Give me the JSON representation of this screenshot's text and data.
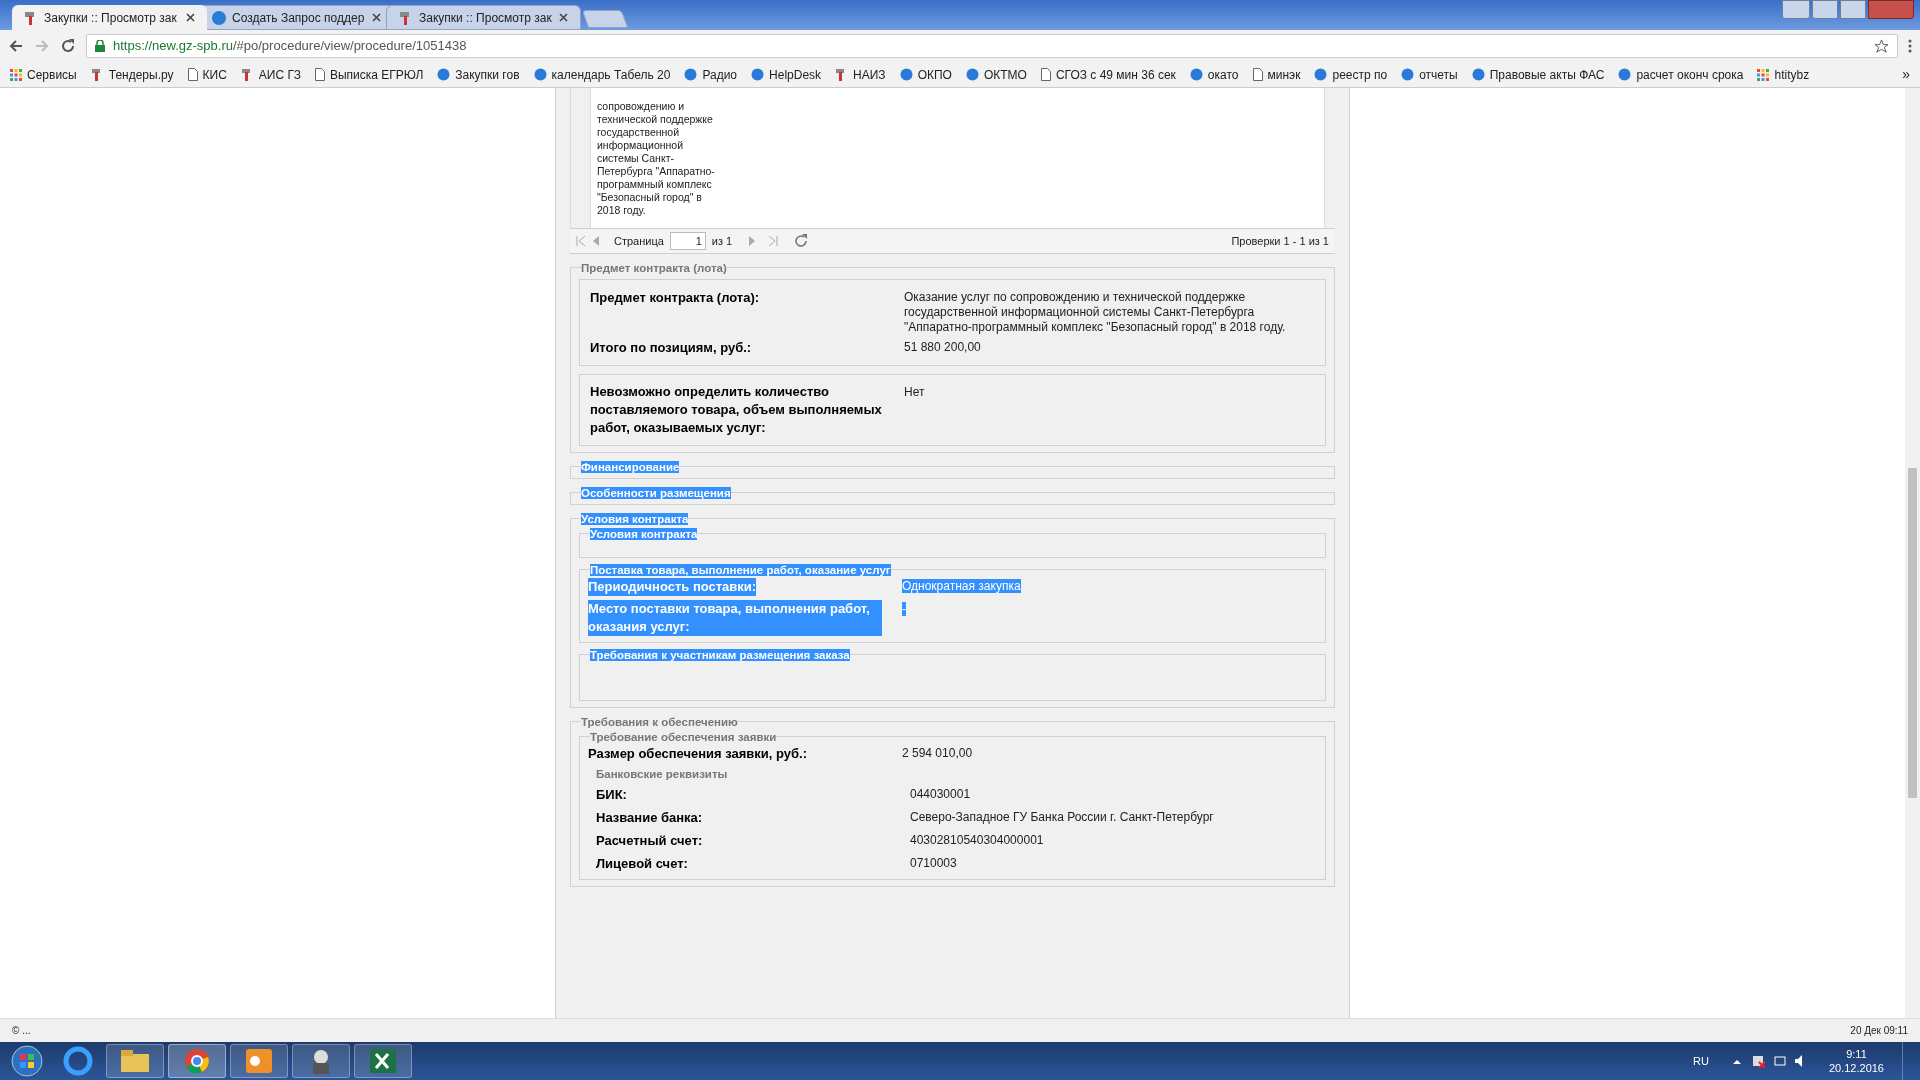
{
  "browser": {
    "tabs": [
      {
        "title": "Закупки :: Просмотр зак",
        "selected": true
      },
      {
        "title": "Создать Запрос поддер",
        "selected": false
      },
      {
        "title": "Закупки :: Просмотр зак",
        "selected": false
      }
    ],
    "url_host": "https://new.gz-spb.ru",
    "url_path": "/#po/procedure/view/procedure/1051438",
    "bookmarks": [
      {
        "label": "Сервисы"
      },
      {
        "label": "Тендеры.ру"
      },
      {
        "label": "КИС"
      },
      {
        "label": "АИС ГЗ"
      },
      {
        "label": "Выписка ЕГРЮЛ"
      },
      {
        "label": "Закупки гов"
      },
      {
        "label": "календарь Табель 20"
      },
      {
        "label": "Радио"
      },
      {
        "label": "HelpDesk"
      },
      {
        "label": "НАИЗ"
      },
      {
        "label": "ОКПО"
      },
      {
        "label": "ОКТМО"
      },
      {
        "label": "СГОЗ с 49 мин 36 сек"
      },
      {
        "label": "окато"
      },
      {
        "label": "минэк"
      },
      {
        "label": "реестр по"
      },
      {
        "label": "отчеты"
      },
      {
        "label": "Правовые акты ФАС"
      },
      {
        "label": "расчет оконч срока"
      },
      {
        "label": "htitybz"
      }
    ],
    "more": "»"
  },
  "grid": {
    "cell": "сопровождению и технической поддержке государственной информационной системы Санкт-Петербурга \"Аппаратно-программный комплекс \"Безопасный город\" в 2018 году.",
    "pager": {
      "page_label": "Страница",
      "page_value": "1",
      "page_of": "из 1",
      "summary": "Проверки 1 - 1 из 1"
    }
  },
  "sections": [
    {
      "kind": "fieldset",
      "legend": "Предмет контракта (лота)",
      "highlighted": false,
      "children": [
        {
          "kind": "box",
          "children": [
            {
              "kind": "field",
              "label": "Предмет контракта (лота):",
              "value": "Оказание услуг по сопровождению и технической поддержке государственной информационной системы Санкт-Петербурга \"Аппаратно-программный комплекс \"Безопасный город\" в 2018 году.",
              "highlighted": false
            },
            {
              "kind": "field",
              "label": "Итого по позициям, руб.:",
              "value": "51 880 200,00",
              "highlighted": false
            }
          ]
        },
        {
          "kind": "box",
          "children": [
            {
              "kind": "field",
              "label": "Невозможно определить количество поставляемого товара, объем выполняемых работ, оказываемых услуг:",
              "value": "Нет",
              "highlighted": false
            }
          ]
        }
      ]
    },
    {
      "kind": "fieldset",
      "legend": "Финансирование",
      "highlighted": true
    },
    {
      "kind": "fieldset",
      "legend": "Особенности размещения",
      "highlighted": true
    },
    {
      "kind": "fieldset",
      "legend": "Условия контракта",
      "highlighted": true,
      "children": [
        {
          "kind": "fieldset",
          "legend": "Условия контракта",
          "highlighted": true
        },
        {
          "kind": "fieldset",
          "legend": "Поставка товара, выполнение работ, оказание услуг",
          "highlighted": true,
          "children": [
            {
              "kind": "field",
              "label": "Периодичность поставки:",
              "value": "Однократная закупка",
              "highlighted": true
            },
            {
              "kind": "field",
              "label": "Место поставки товара, выполнения работ, оказания услуг:",
              "value": "-",
              "highlighted": true
            }
          ]
        },
        {
          "kind": "fieldset",
          "legend": "Требования к участникам размещения заказа",
          "highlighted": true
        }
      ]
    },
    {
      "kind": "fieldset",
      "legend": "Требования к обеспечению",
      "highlighted": false,
      "children": [
        {
          "kind": "fieldset",
          "legend": "Требование обеспечения заявки",
          "highlighted": false,
          "children": [
            {
              "kind": "field",
              "label": "Размер обеспечения заявки, руб.:",
              "value": "2 594 010,00",
              "highlighted": false
            },
            {
              "kind": "subheading",
              "text": "Банковские реквизиты"
            },
            {
              "kind": "subfield",
              "label": "БИК:",
              "value": "044030001"
            },
            {
              "kind": "subfield",
              "label": "Название банка:",
              "value": "Северо-Западное ГУ Банка России г. Санкт-Петербург"
            },
            {
              "kind": "subfield",
              "label": "Расчетный счет:",
              "value": "40302810540304000001"
            },
            {
              "kind": "subfield",
              "label": "Лицевой счет:",
              "value": "0710003"
            }
          ]
        }
      ]
    }
  ],
  "status_bar": {
    "left": "© ...",
    "right": "20 Дек 09:11"
  },
  "taskbar": {
    "language": "RU",
    "time": "9:11",
    "date": "20.12.2016"
  }
}
